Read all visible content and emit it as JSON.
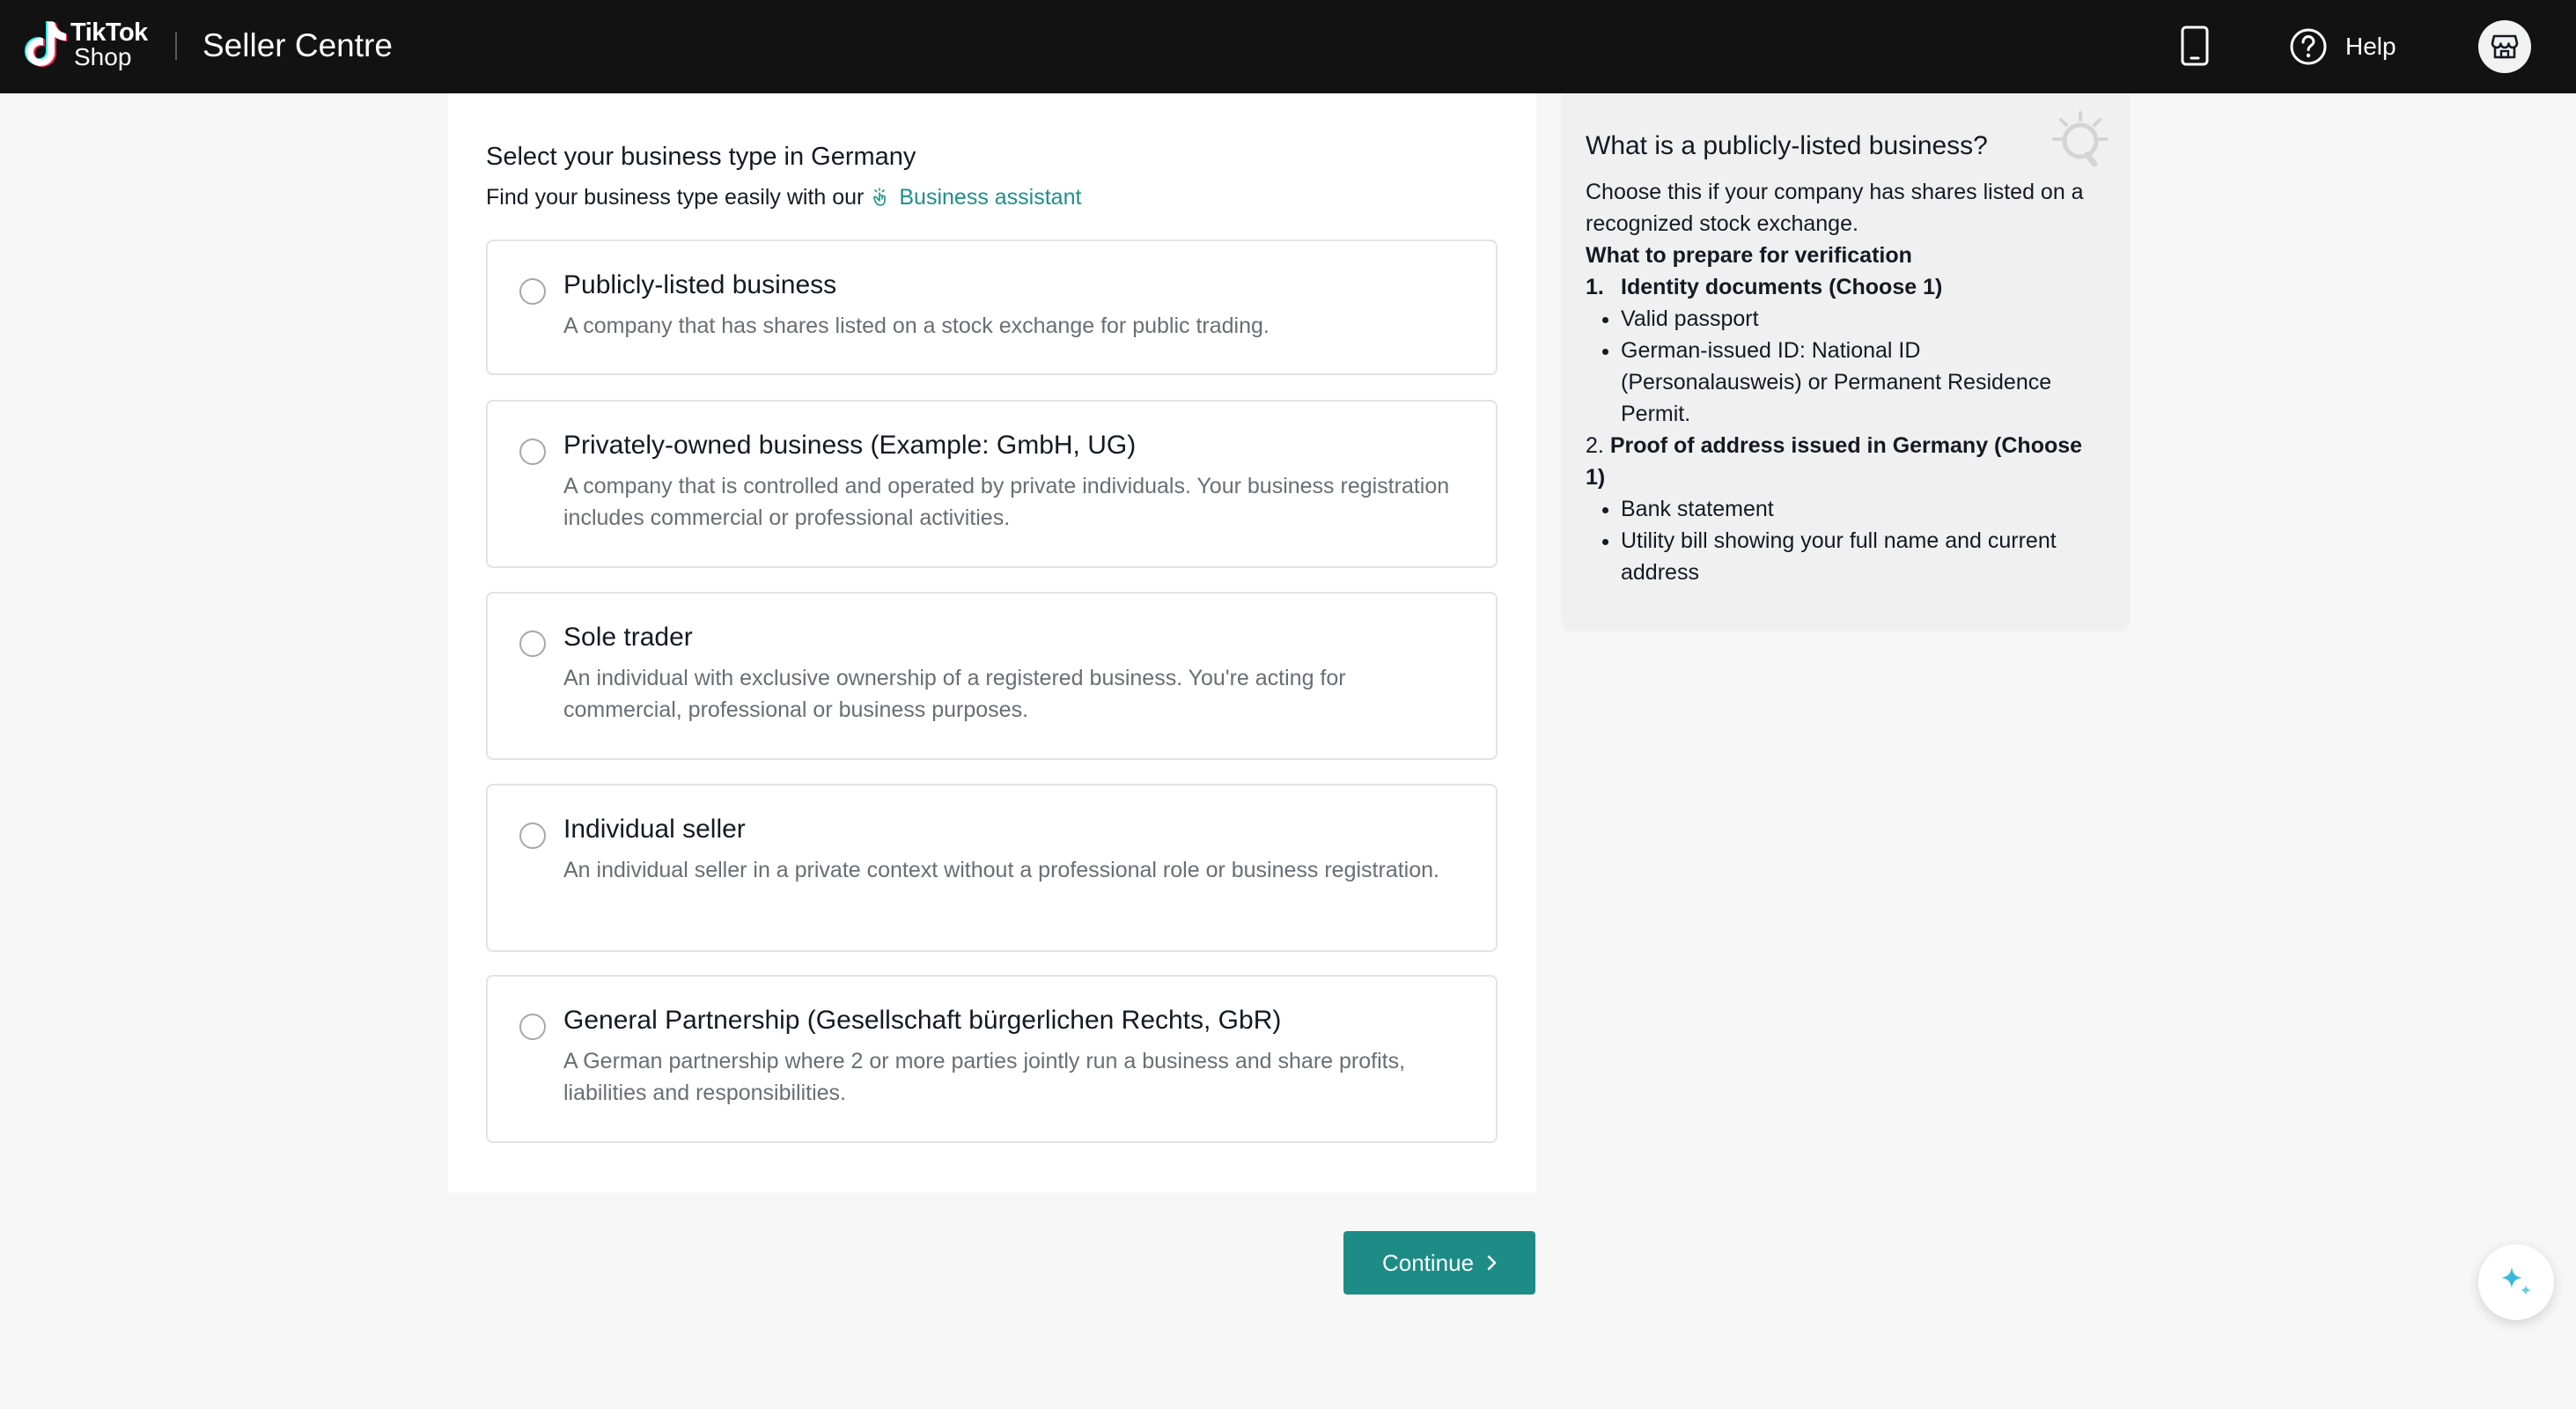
{
  "header": {
    "logo_line1": "TikTok",
    "logo_line2": "Shop",
    "title": "Seller Centre",
    "help_label": "Help",
    "icons": {
      "phone": "mobile-phone-icon",
      "help": "question-circle-icon",
      "shop": "store-icon"
    }
  },
  "form": {
    "title": "Select your business type in Germany",
    "subtitle_prefix": "Find your business type easily with our",
    "assistant_link": "Business assistant",
    "options": [
      {
        "title": "Publicly-listed business",
        "description": "A company that has shares listed on a stock exchange for public trading.",
        "selected": false
      },
      {
        "title": "Privately-owned business (Example: GmbH, UG)",
        "description": "A company that is controlled and operated by private individuals. Your business registration includes commercial or professional activities.",
        "selected": false
      },
      {
        "title": "Sole trader",
        "description": "An individual with exclusive ownership of a registered business. You're acting for commercial, professional or business purposes.",
        "selected": false
      },
      {
        "title": "Individual seller",
        "description": "An individual seller in a private context without a professional role or business registration.",
        "selected": false
      },
      {
        "title": "General Partnership (Gesellschaft bürgerlichen Rechts, GbR)",
        "description": "A German partnership where 2 or more parties jointly run a business and share profits, liabilities and responsibilities.",
        "selected": false
      }
    ],
    "continue_label": "Continue"
  },
  "info_panel": {
    "title": "What is a publicly-listed business?",
    "intro": "Choose this if your company has shares listed on a recognized stock exchange.",
    "prepare_heading": "What to prepare for verification",
    "section1_number": "1.",
    "section1_title": "Identity documents (Choose 1)",
    "section1_items": [
      "Valid passport",
      "German-issued ID: National ID (Personalausweis) or Permanent Residence Permit."
    ],
    "section2_number": "2.",
    "section2_title": "Proof of address issued in Germany (Choose 1)",
    "section2_items": [
      "Bank statement",
      "Utility bill showing your full name and current address"
    ]
  },
  "colors": {
    "topbar": "#121212",
    "accent": "#1e8c86",
    "link": "#1d8f89",
    "panel_bg": "#f0f0f0",
    "page_bg": "#f7f7f7"
  }
}
